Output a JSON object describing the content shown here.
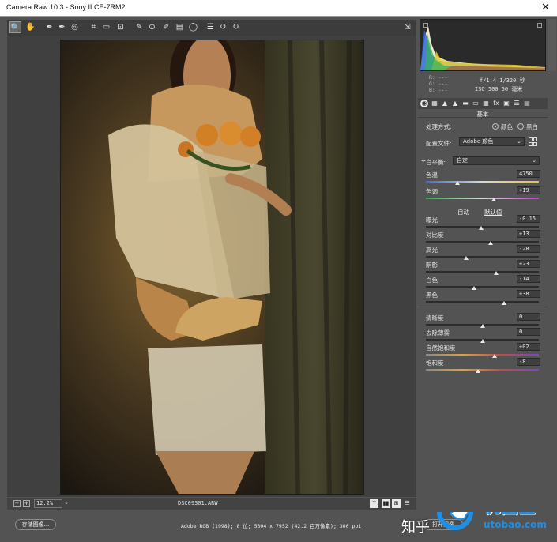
{
  "window": {
    "title": "Camera Raw 10.3 -  Sony ILCE-7RM2",
    "close_glyph": "✕"
  },
  "toolbar": {
    "tools": [
      {
        "name": "zoom-tool",
        "glyph": "🔍"
      },
      {
        "name": "hand-tool",
        "glyph": "✋"
      },
      {
        "name": "white-balance-tool",
        "glyph": "✒"
      },
      {
        "name": "color-sampler-tool",
        "glyph": "✒"
      },
      {
        "name": "targeted-adjustment-tool",
        "glyph": "◎"
      },
      {
        "name": "crop-tool",
        "glyph": "⌗"
      },
      {
        "name": "straighten-tool",
        "glyph": "▭"
      },
      {
        "name": "transform-tool",
        "glyph": "⊡"
      },
      {
        "name": "spot-removal-tool",
        "glyph": "✎"
      },
      {
        "name": "red-eye-tool",
        "glyph": "⊙"
      },
      {
        "name": "adjustment-brush-tool",
        "glyph": "✐"
      },
      {
        "name": "graduated-filter-tool",
        "glyph": "▤"
      },
      {
        "name": "radial-filter-tool",
        "glyph": "◯"
      },
      {
        "name": "preferences-tool",
        "glyph": "☰"
      },
      {
        "name": "rotate-left-tool",
        "glyph": "↺"
      },
      {
        "name": "rotate-right-tool",
        "glyph": "↻"
      }
    ],
    "fullscreen_glyph": "⇲"
  },
  "status": {
    "zoom": "12.2%",
    "filename": "DSC09301.ARW",
    "view_buttons": [
      "Y",
      "▮▮",
      "⊞",
      "☰"
    ]
  },
  "bottom": {
    "save_label": "存储图像...",
    "workflow_link": "Adobe RGB (1998); 8 位; 5304 x 7952 (42.2 百万像素); 300 ppi",
    "open_label": "打开图像"
  },
  "watermark": {
    "zhihu": "知乎",
    "brand": "优图宝",
    "domain": "utobao.com"
  },
  "panel": {
    "rgb": {
      "r": "R:  ---",
      "g": "G:  ---",
      "b": "B:  ---"
    },
    "exif": {
      "aperture_shutter": "f/1.4  1/320 秒",
      "iso_focal": "ISO 500  50 毫米"
    },
    "tabs": [
      "◉",
      "▦",
      "▲",
      "▲",
      "▬",
      "▭",
      "▦",
      "fx",
      "▣",
      "☰",
      "▤"
    ],
    "section_title": "基本",
    "treatment": {
      "label": "处理方式:",
      "color": "颜色",
      "bw": "黑白"
    },
    "profile": {
      "label": "配置文件:",
      "value": "Adobe 颜色"
    },
    "white_balance": {
      "label": "白平衡:",
      "value": "自定"
    },
    "auto_label": "自动",
    "default_label": "默认值",
    "wb_sliders": [
      {
        "label": "色温",
        "value": "4750",
        "level": 0.28
      },
      {
        "label": "色调",
        "value": "+19",
        "level": 0.6
      }
    ],
    "tone_sliders": [
      {
        "label": "曝光",
        "value": "-0.15",
        "level": 0.49
      },
      {
        "label": "对比度",
        "value": "+13",
        "level": 0.57
      },
      {
        "label": "高光",
        "value": "-28",
        "level": 0.36
      },
      {
        "label": "阴影",
        "value": "+23",
        "level": 0.62
      },
      {
        "label": "白色",
        "value": "-14",
        "level": 0.43
      },
      {
        "label": "黑色",
        "value": "+38",
        "level": 0.69
      }
    ],
    "presence_sliders": [
      {
        "label": "清晰度",
        "value": "0",
        "level": 0.5
      },
      {
        "label": "去除薄雾",
        "value": "0",
        "level": 0.5
      },
      {
        "label": "自然饱和度",
        "value": "+02",
        "level": 0.61
      },
      {
        "label": "饱和度",
        "value": "-8",
        "level": 0.46
      }
    ]
  }
}
